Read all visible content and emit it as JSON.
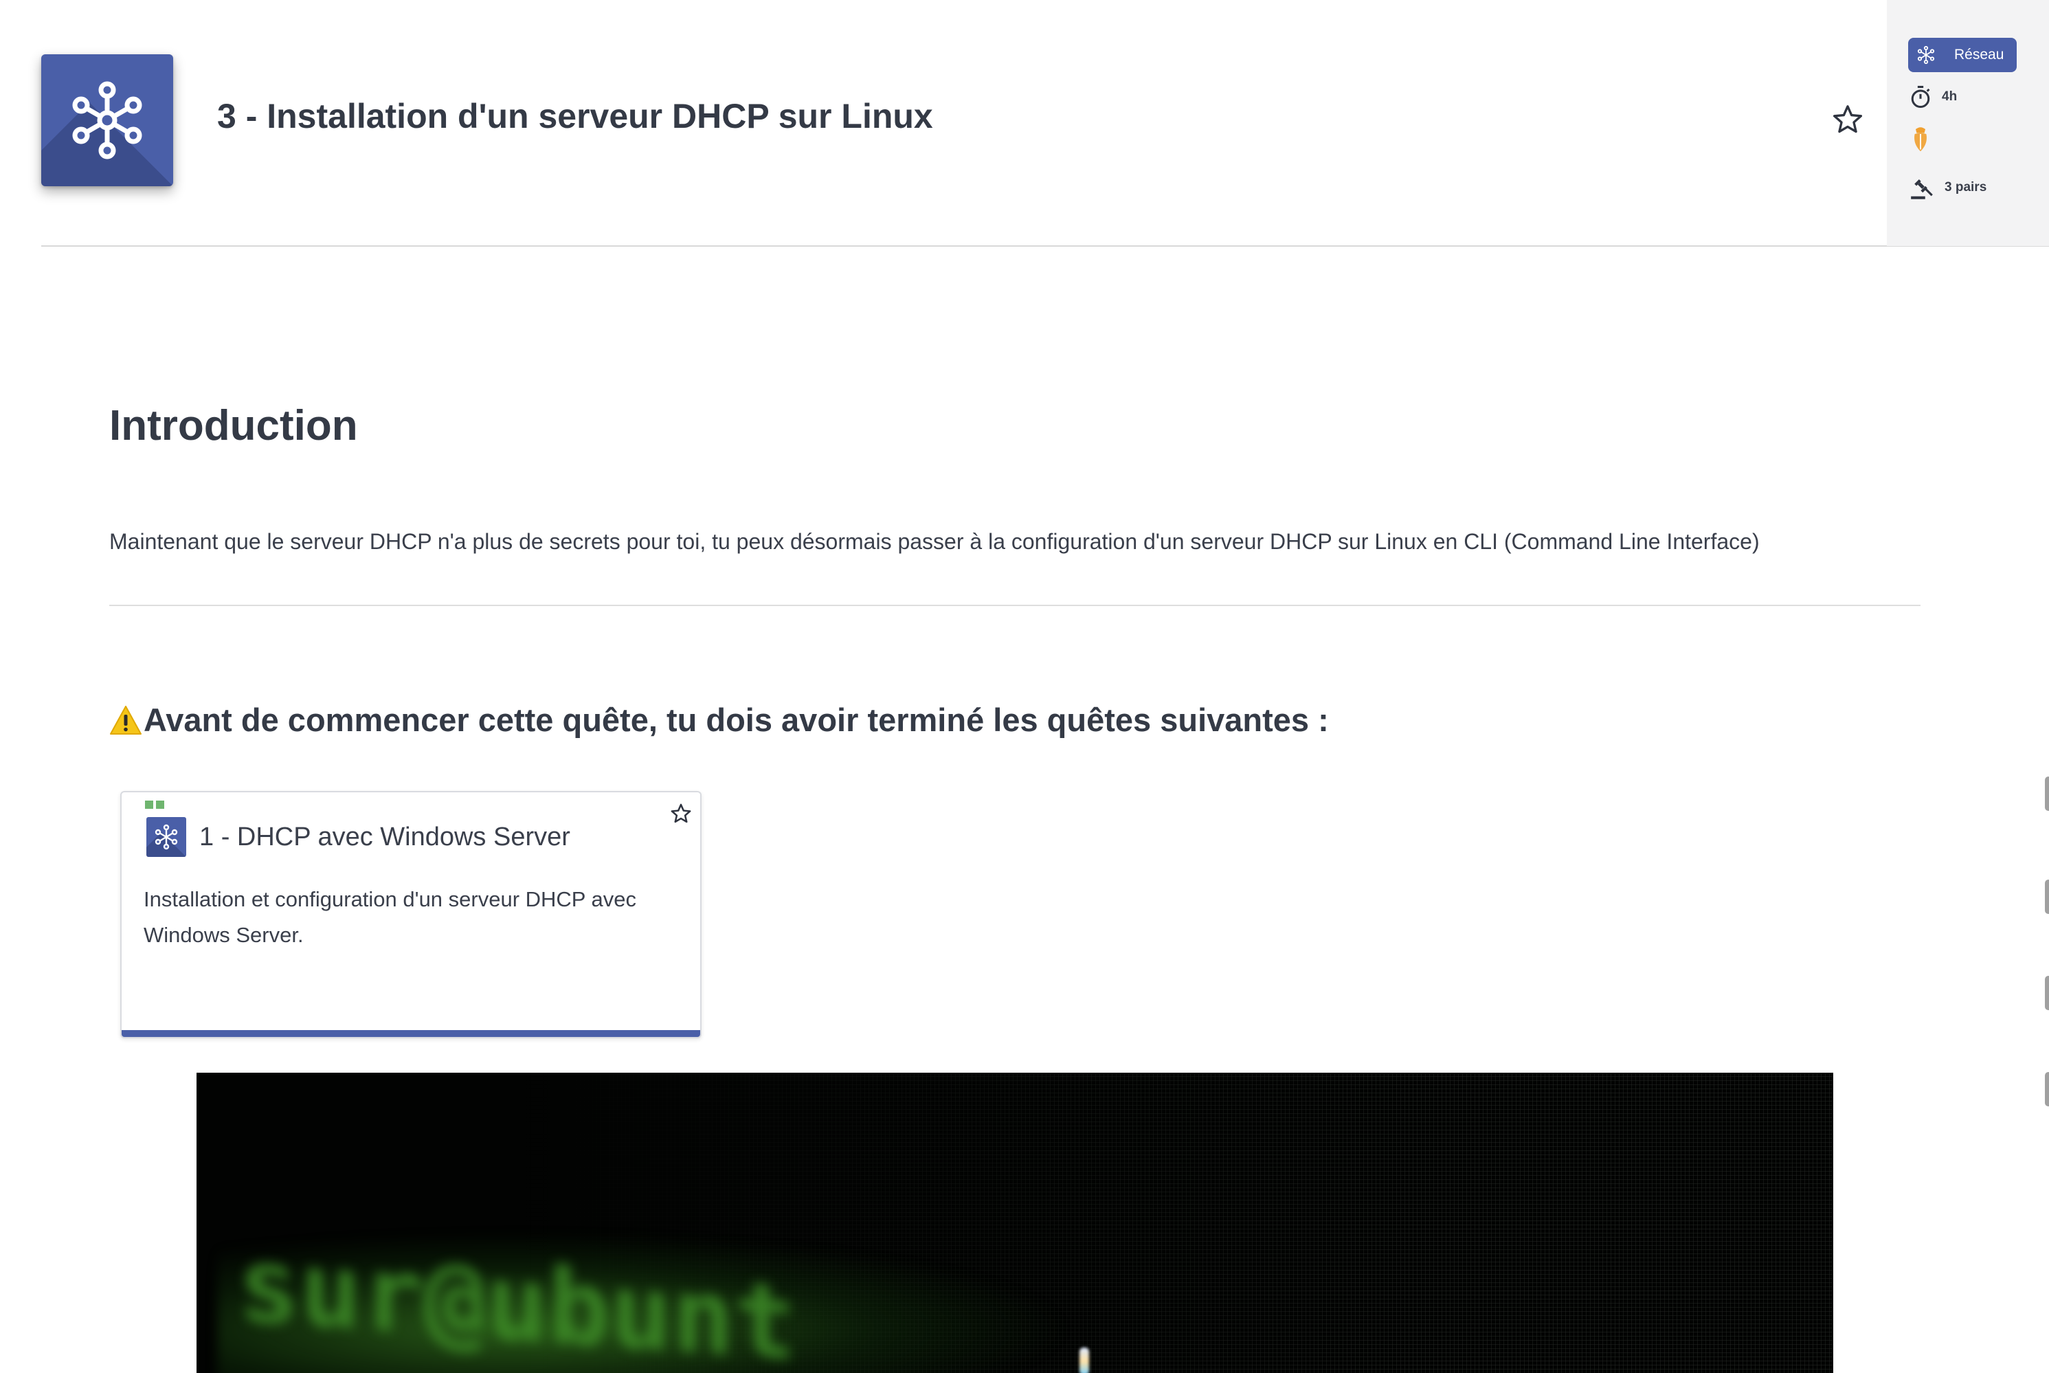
{
  "quest": {
    "title": "3 - Installation d'un serveur DHCP sur Linux",
    "icon": "network-hub-icon"
  },
  "meta": {
    "tag_label": "Réseau",
    "tag_icon": "network-hub-icon",
    "duration": "4h",
    "duration_icon": "stopwatch-icon",
    "difficulty_icon": "bug-icon",
    "difficulty_color": "#f0a030",
    "review": "3 pairs",
    "review_icon": "gavel-icon"
  },
  "content": {
    "intro_heading": "Introduction",
    "intro_text": "Maintenant que le serveur DHCP n'a plus de secrets pour toi, tu peux désormais passer à la configuration d'un serveur DHCP sur Linux en CLI (Command Line Interface)",
    "prereq_heading": "Avant de commencer cette quête, tu dois avoir terminé les quêtes suivantes :",
    "prereq_icon": "warning-icon"
  },
  "prerequisites": [
    {
      "title": "1 - DHCP avec Windows Server",
      "description": "Installation et configuration d'un serveur DHCP avec Windows Server.",
      "icon": "network-hub-icon"
    }
  ],
  "colors": {
    "accent": "#4a5fa8",
    "status_done": "#6fb56f"
  }
}
